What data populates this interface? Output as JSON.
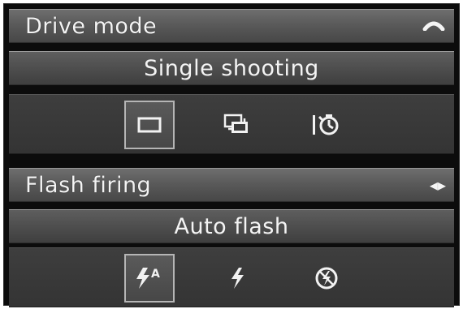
{
  "drive_mode": {
    "title": "Drive mode",
    "indicator_icon": "arc-scroll-icon",
    "current_value": "Single shooting",
    "options": [
      {
        "icon": "single-shooting-icon",
        "selected": true
      },
      {
        "icon": "continuous-shooting-icon",
        "selected": false
      },
      {
        "icon": "self-timer-icon",
        "selected": false
      }
    ]
  },
  "flash_firing": {
    "title": "Flash firing",
    "indicator_icon": "left-right-arrows-icon",
    "indicator_glyph": "◂▸",
    "current_value": "Auto flash",
    "options": [
      {
        "icon": "auto-flash-icon",
        "selected": true
      },
      {
        "icon": "flash-on-icon",
        "selected": false
      },
      {
        "icon": "flash-off-icon",
        "selected": false
      }
    ]
  }
}
